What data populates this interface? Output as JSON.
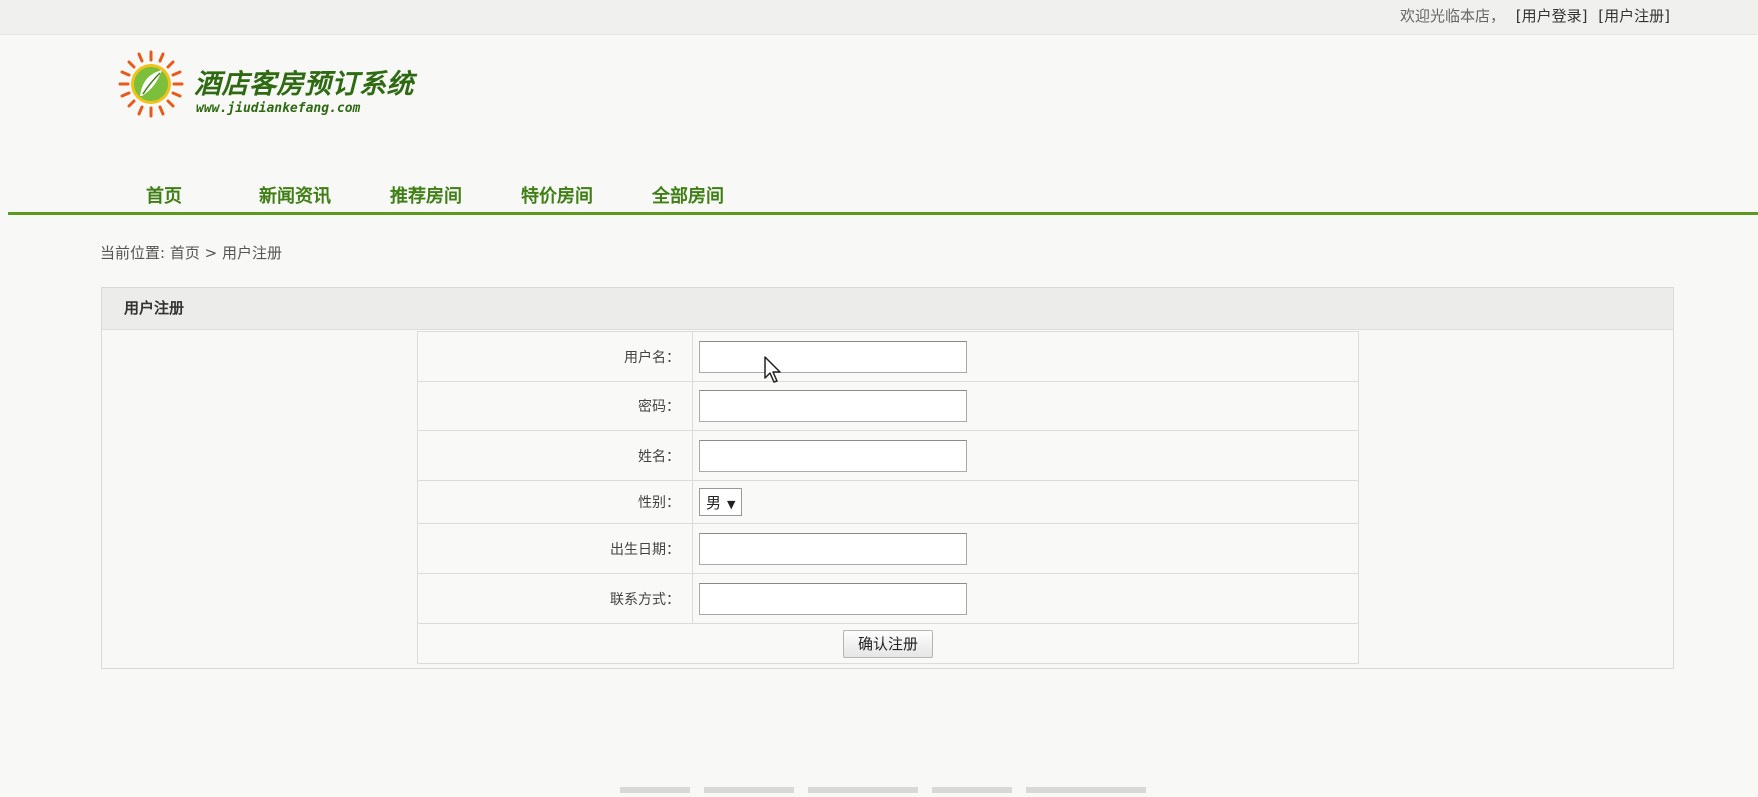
{
  "topbar": {
    "welcome": "欢迎光临本店，",
    "login_link": "[用户登录]",
    "register_link": "[用户注册]"
  },
  "logo": {
    "title": "酒店客房预订系统",
    "url": "www.jiudiankefang.com",
    "icon": "sun-leaf-logo-icon"
  },
  "nav": {
    "items": [
      {
        "label": "首页"
      },
      {
        "label": "新闻资讯"
      },
      {
        "label": "推荐房间"
      },
      {
        "label": "特价房间"
      },
      {
        "label": "全部房间"
      }
    ],
    "accent_color": "#5a9a1e"
  },
  "breadcrumb": {
    "prefix": "当前位置:",
    "home": "首页",
    "separator": ">",
    "current": "用户注册"
  },
  "panel": {
    "title": "用户注册"
  },
  "form": {
    "username_label": "用户名：",
    "password_label": "密码：",
    "name_label": "姓名：",
    "gender_label": "性别：",
    "gender_value": "男",
    "birthday_label": "出生日期：",
    "contact_label": "联系方式：",
    "submit_label": "确认注册"
  }
}
